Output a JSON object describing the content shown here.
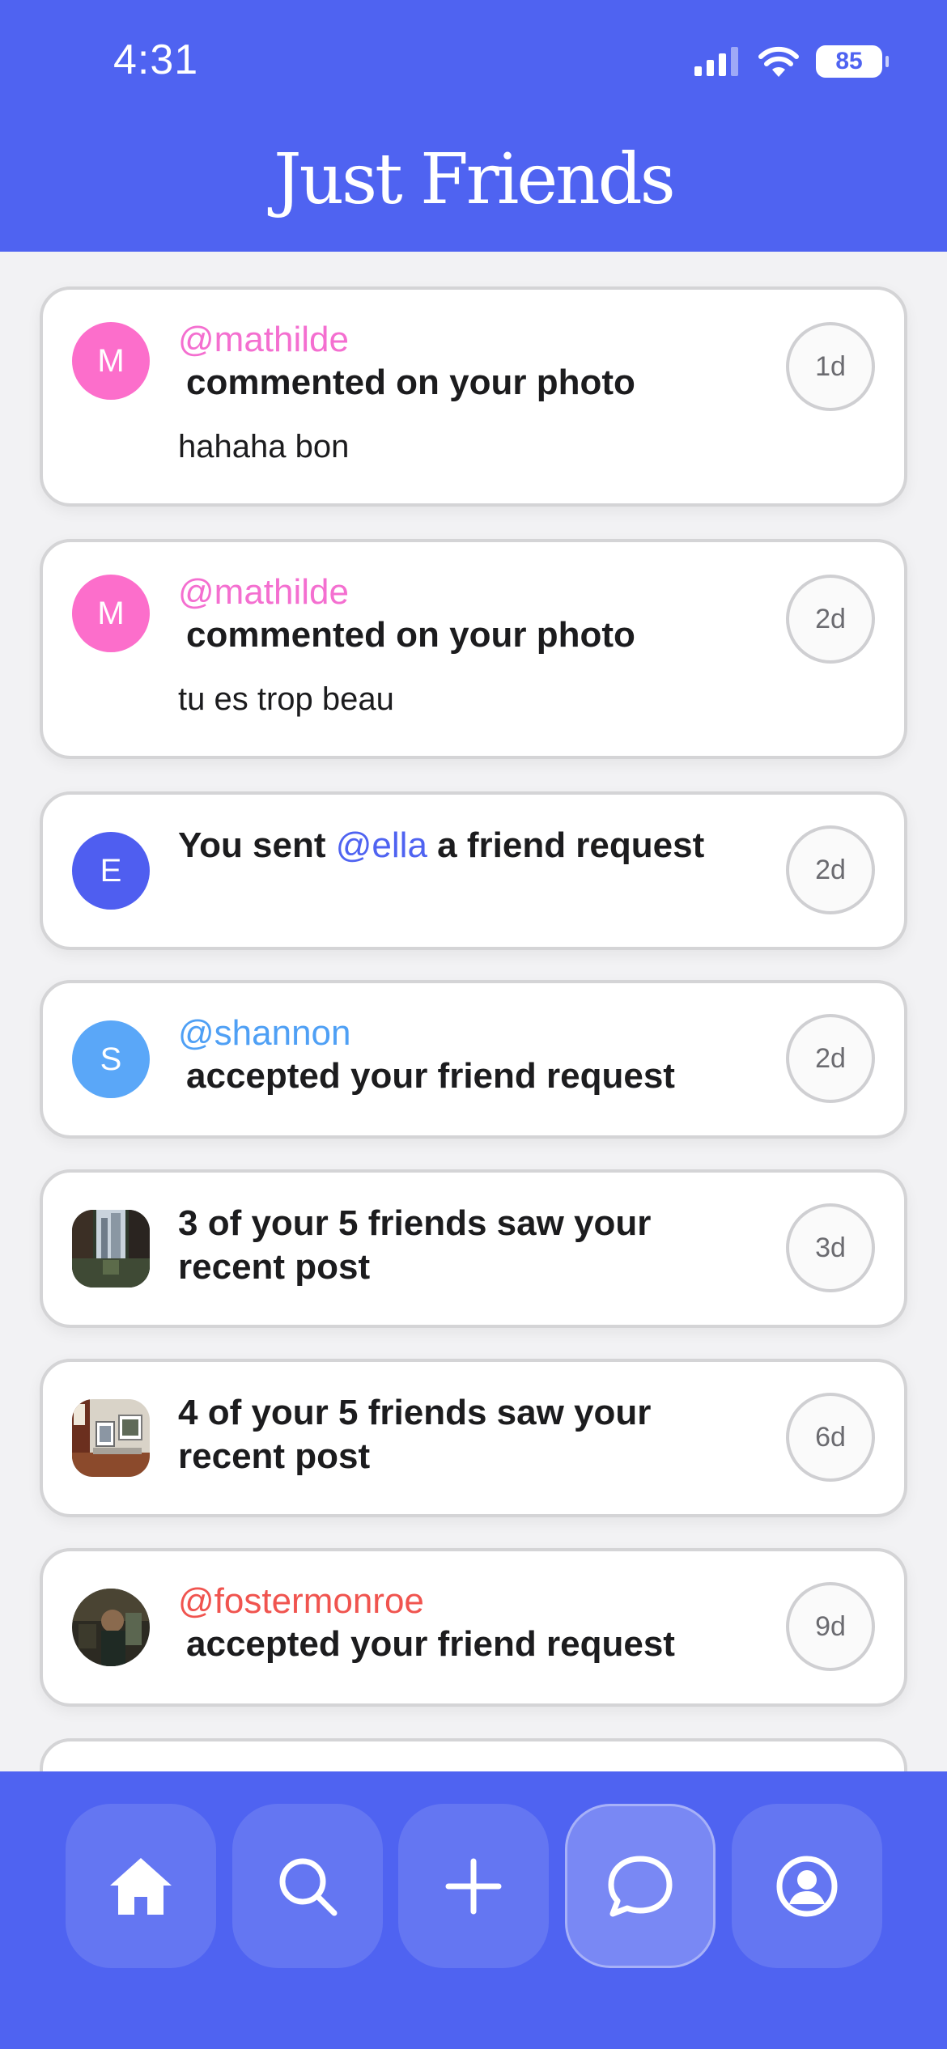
{
  "status_bar": {
    "time": "4:31",
    "battery": "85",
    "icons": [
      "cellular-signal-icon",
      "wifi-icon",
      "battery-icon"
    ]
  },
  "header": {
    "title": "Just Friends"
  },
  "notifications": [
    {
      "avatar_letter": "M",
      "avatar_color": "#fc6ecb",
      "handle": "@mathilde",
      "handle_color": "#f46fd0",
      "action": "commented on your photo",
      "comment": "hahaha bon",
      "time": "1d"
    },
    {
      "avatar_letter": "M",
      "avatar_color": "#fc6ecb",
      "handle": "@mathilde",
      "handle_color": "#f46fd0",
      "action": "commented on your photo",
      "comment": "tu es trop beau",
      "time": "2d"
    },
    {
      "avatar_letter": "E",
      "avatar_color": "#4f5ef0",
      "text_before": "You sent ",
      "mention": "@ella",
      "mention_color": "#4f63f1",
      "text_after": " a friend request",
      "time": "2d"
    },
    {
      "avatar_letter": "S",
      "avatar_color": "#5aa7f8",
      "handle": "@shannon",
      "handle_color": "#4fa0f5",
      "action": "accepted your friend request",
      "time": "2d"
    },
    {
      "avatar_image": "post-photo-thumbnail-city",
      "text": "3 of your 5 friends saw your recent post",
      "time": "3d"
    },
    {
      "avatar_image": "post-photo-thumbnail-room",
      "text": "4 of your 5 friends saw your recent post",
      "time": "6d"
    },
    {
      "avatar_image": "profile-photo-fostermonroe",
      "handle": "@fostermonroe",
      "handle_color": "#f0544f",
      "action": "accepted your friend request",
      "time": "9d"
    }
  ],
  "tab_bar": {
    "tabs": [
      {
        "icon": "home-icon",
        "active": false
      },
      {
        "icon": "search-icon",
        "active": false
      },
      {
        "icon": "plus-icon",
        "active": false
      },
      {
        "icon": "chat-bubble-icon",
        "active": true
      },
      {
        "icon": "profile-icon",
        "active": false
      }
    ]
  },
  "colors": {
    "brand": "#4f63f1",
    "background": "#f2f2f4",
    "card_border": "#d4d4d6"
  }
}
